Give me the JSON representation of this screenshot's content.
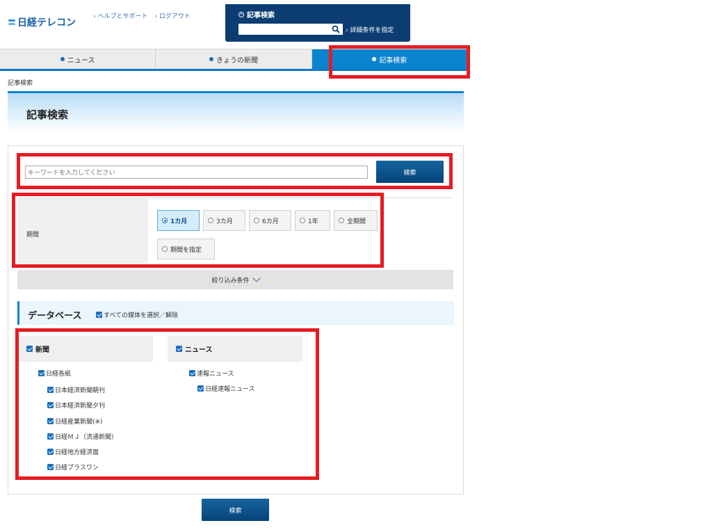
{
  "header": {
    "logo_text": "日経テレコン",
    "help_link": "› ヘルプとサポート",
    "logout_link": "› ログアウト",
    "quick_search": {
      "title": "記事検索",
      "input_value": "",
      "detail_link": "› 詳細条件を指定"
    }
  },
  "nav": {
    "tabs": [
      {
        "label": "ニュース"
      },
      {
        "label": "きょうの新聞"
      },
      {
        "label": "記事検索"
      }
    ]
  },
  "breadcrumb": "記事検索",
  "page_title": "記事検索",
  "keyword": {
    "placeholder": "キーワードを入力してください",
    "button_label": "検索"
  },
  "period": {
    "label": "期間",
    "options": [
      "1カ月",
      "3カ月",
      "6カ月",
      "1年",
      "全期間",
      "期間を指定"
    ],
    "selected": "1カ月"
  },
  "filter_toggle_label": "絞り込み条件",
  "database": {
    "title": "データベース",
    "select_all_label": "すべての媒体を選択／解除",
    "categories": [
      {
        "name": "新聞",
        "group": "日経各紙",
        "items": [
          "日本経済新聞朝刊",
          "日本経済新聞夕刊",
          "日経産業新聞(※)",
          "日経ＭＪ（流通新聞）",
          "日経地方経済面",
          "日経プラスワン"
        ]
      },
      {
        "name": "ニュース",
        "group": "速報ニュース",
        "items": [
          "日経速報ニュース"
        ]
      }
    ]
  },
  "bottom_search_label": "検索",
  "colors": {
    "accent": "#0b84d0",
    "header_dark": "#0b3d72",
    "highlight_red": "#e51c23"
  }
}
